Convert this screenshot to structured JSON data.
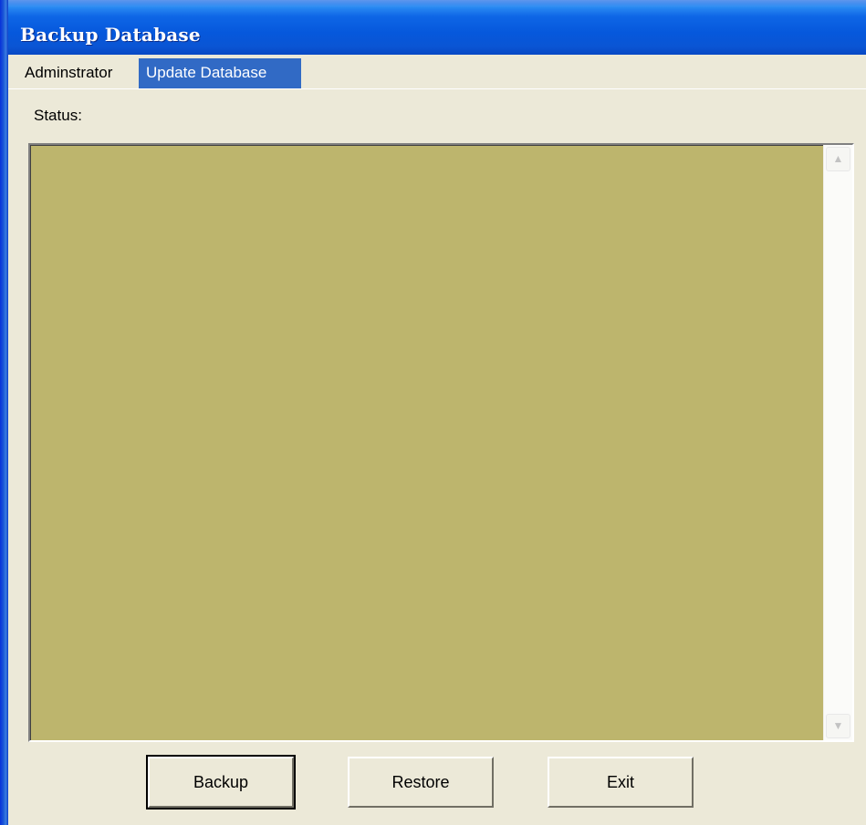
{
  "window": {
    "title": "Backup Database"
  },
  "menu": {
    "items": [
      {
        "label": "Adminstrator",
        "selected": false
      },
      {
        "label": "Update Database",
        "selected": true
      }
    ]
  },
  "main": {
    "status_label": "Status:",
    "status_box_color": "#bdb56d"
  },
  "buttons": {
    "backup_label": "Backup",
    "restore_label": "Restore",
    "exit_label": "Exit"
  },
  "colors": {
    "titlebar": "#0a5ee3",
    "menu_highlight": "#316ac5",
    "window_bg": "#ece9d8"
  }
}
